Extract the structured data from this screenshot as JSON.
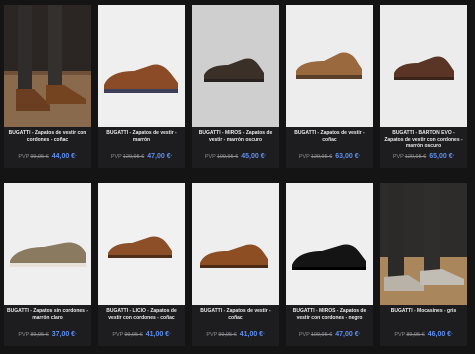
{
  "products": [
    {
      "title": "BUGATTI - Zapatos de vestir con cordones - coñac",
      "pvp": "PVP",
      "old_price": "99,95 €",
      "new_price": "44,00 €",
      "sup": "*",
      "image": "legs-brown-shoes",
      "bg": "#6a4a34"
    },
    {
      "title": "BUGATTI - Zapatos de vestir - marrón",
      "pvp": "PVP",
      "old_price": "129,95 €",
      "new_price": "47,00 €",
      "sup": "*",
      "image": "brown-suede-derby",
      "bg": "#efefef"
    },
    {
      "title": "BUGATTI - MIROS - Zapatos de vestir - marrón oscuro",
      "pvp": "PVP",
      "old_price": "109,95 €",
      "new_price": "45,00 €",
      "sup": "*",
      "image": "dark-brown-derby",
      "bg": "#d0d0d0"
    },
    {
      "title": "BUGATTI - Zapatos de vestir - coñac",
      "pvp": "PVP",
      "old_price": "129,95 €",
      "new_price": "63,00 €",
      "sup": "*",
      "image": "tan-derby",
      "bg": "#ededed"
    },
    {
      "title": "BUGATTI - BARTON EVO - Zapatos de vestir con cordones - marrón oscuro",
      "pvp": "PVP",
      "old_price": "129,95 €",
      "new_price": "65,00 €",
      "sup": "*",
      "image": "dark-brown-derby-2",
      "bg": "#ececec"
    },
    {
      "title": "BUGATTI - Zapatos sin cordones - marrón claro",
      "pvp": "PVP",
      "old_price": "89,95 €",
      "new_price": "37,00 €",
      "sup": "*",
      "image": "slip-on-perforated",
      "bg": "#efefef"
    },
    {
      "title": "BUGATTI - LICIO - Zapatos de vestir con cordones - coñac",
      "pvp": "PVP",
      "old_price": "99,95 €",
      "new_price": "41,00 €",
      "sup": "*",
      "image": "cognac-derby",
      "bg": "#f1f1f1"
    },
    {
      "title": "BUGATTI - Zapatos de vestir - coñac",
      "pvp": "PVP",
      "old_price": "99,95 €",
      "new_price": "41,00 €",
      "sup": "*",
      "image": "cognac-derby-2",
      "bg": "#eeeeee"
    },
    {
      "title": "BUGATTI - MIROS - Zapatos de vestir con cordones - negro",
      "pvp": "PVP",
      "old_price": "109,95 €",
      "new_price": "47,00 €",
      "sup": "*",
      "image": "black-derby",
      "bg": "#efefef"
    },
    {
      "title": "BUGATTI - Mocasines - gris",
      "pvp": "PVP",
      "old_price": "89,95 €",
      "new_price": "46,00 €",
      "sup": "*",
      "image": "legs-grey-loafers",
      "bg": "#3a3a3a"
    }
  ]
}
